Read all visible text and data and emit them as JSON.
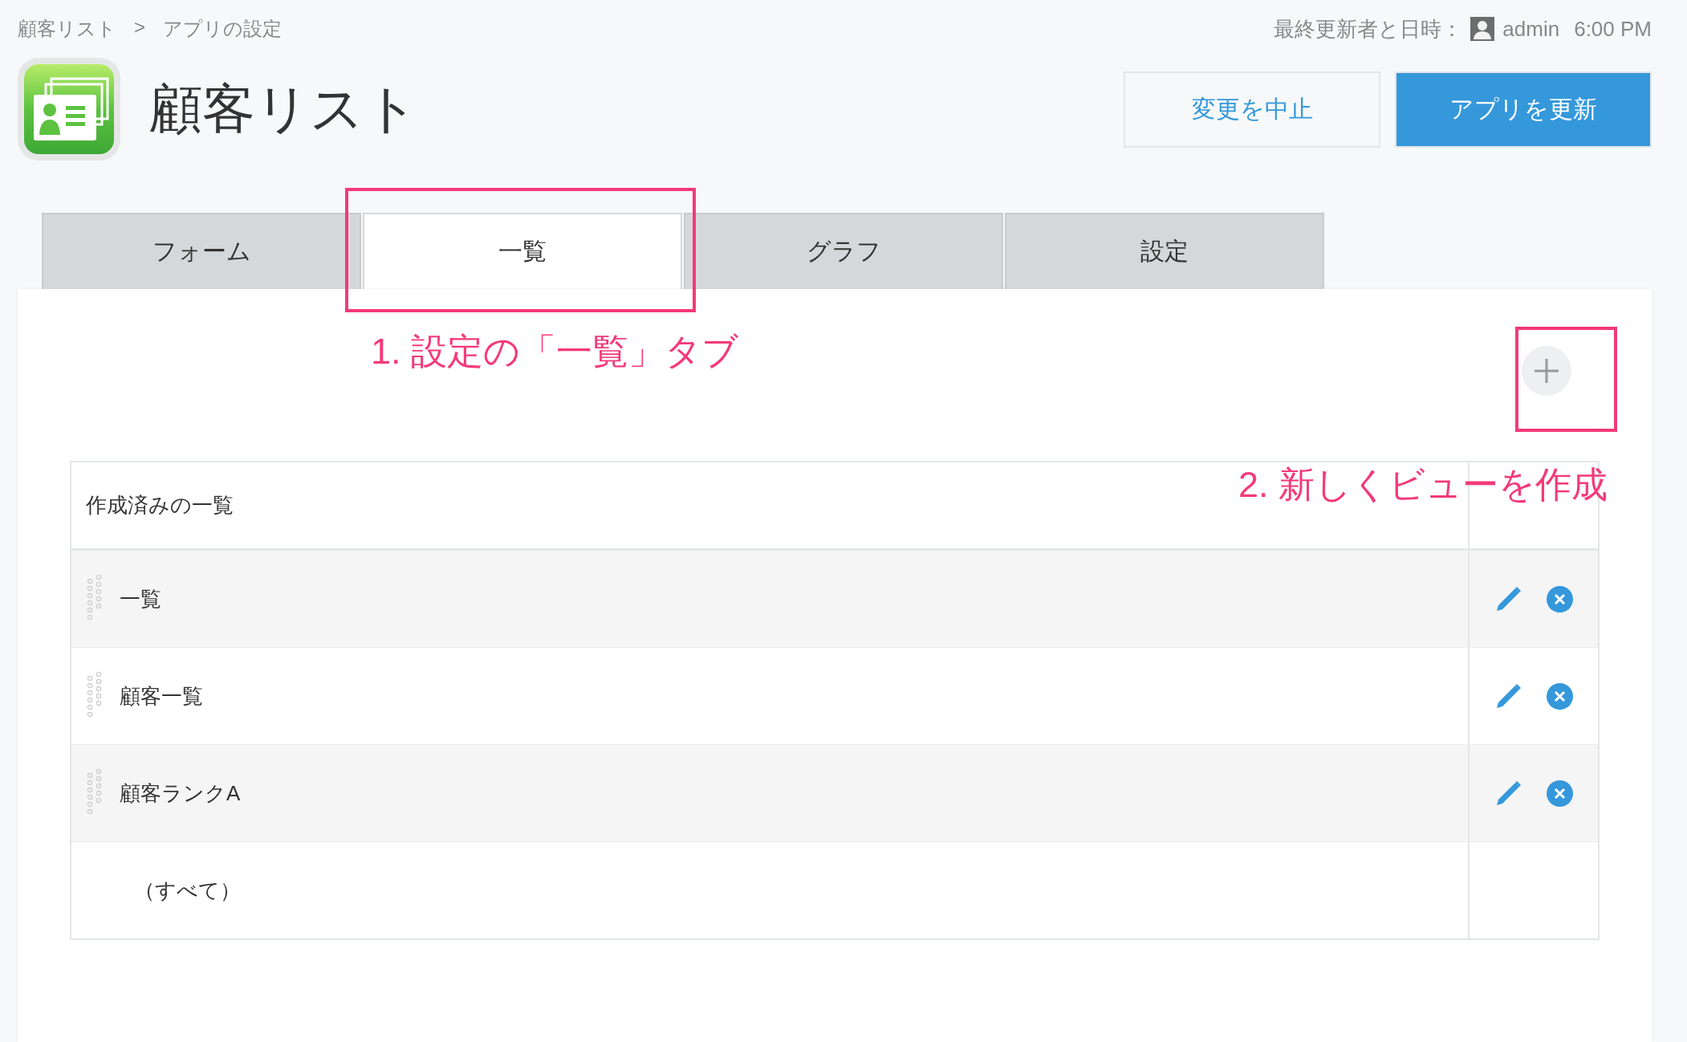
{
  "breadcrumb": {
    "items": [
      "顧客リスト",
      "アプリの設定"
    ],
    "separator": ">"
  },
  "app": {
    "title": "顧客リスト"
  },
  "last_updated": {
    "label": "最終更新者と日時：",
    "user": "admin",
    "time": "6:00 PM"
  },
  "buttons": [
    {
      "label": "変更を中止",
      "kind": "secondary"
    },
    {
      "label": "アプリを更新",
      "kind": "primary"
    }
  ],
  "tabs": [
    {
      "label": "フォーム",
      "selected": false
    },
    {
      "label": "一覧",
      "selected": true
    },
    {
      "label": "グラフ",
      "selected": false
    },
    {
      "label": "設定",
      "selected": false
    }
  ],
  "views_table": {
    "header": "作成済みの一覧",
    "rows": [
      {
        "name": "一覧",
        "kind": "view"
      },
      {
        "name": "顧客一覧",
        "kind": "view"
      },
      {
        "name": "顧客ランクA",
        "kind": "view"
      },
      {
        "name": "（すべて）",
        "kind": "all"
      }
    ]
  },
  "annotations": [
    {
      "text": "1. 設定の「一覧」タブ",
      "kind": "tabs"
    },
    {
      "text": "2. 新しくビューを作成",
      "kind": "add"
    }
  ]
}
